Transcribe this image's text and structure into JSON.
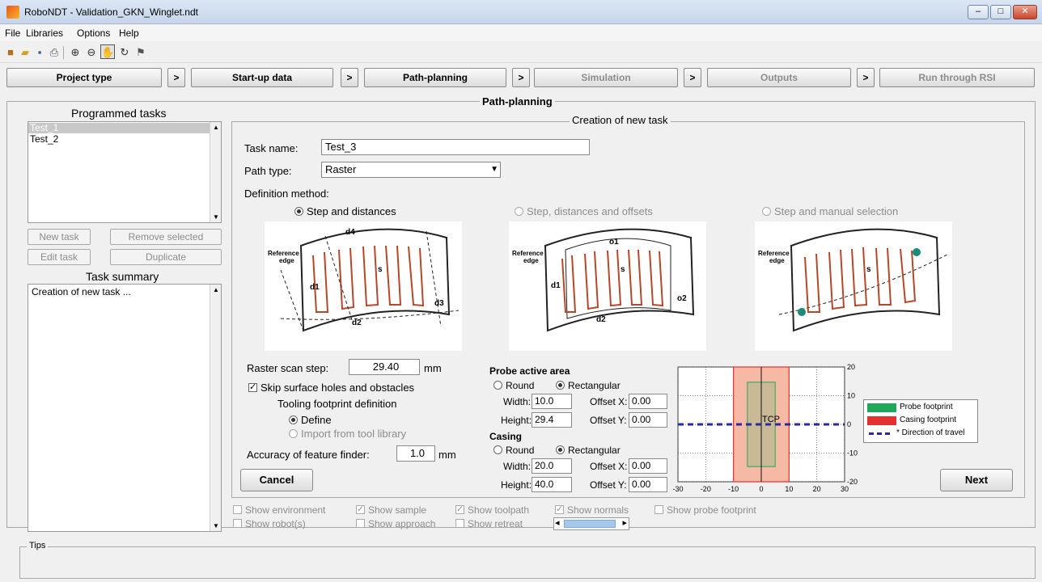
{
  "window": {
    "title": "RoboNDT - Validation_GKN_Winglet.ndt",
    "controls": {
      "minimize": "–",
      "maximize": "□",
      "close": "✕"
    }
  },
  "menu": [
    "File",
    "Libraries",
    "Options",
    "Help"
  ],
  "toolbar_icons": [
    "new-project-icon",
    "open-folder-icon",
    "save-icon",
    "print-icon",
    "zoom-in-icon",
    "zoom-out-icon",
    "pan-hand-icon",
    "rotate-3d-icon",
    "data-cursor-icon"
  ],
  "steps": [
    {
      "label": "Project type",
      "enabled": true
    },
    {
      "label": "Start-up data",
      "enabled": true
    },
    {
      "label": "Path-planning",
      "enabled": true
    },
    {
      "label": "Simulation",
      "enabled": false
    },
    {
      "label": "Outputs",
      "enabled": false
    },
    {
      "label": "Run through RSI",
      "enabled": false
    }
  ],
  "step_arrow": ">",
  "main_panel_title": "Path-planning",
  "left": {
    "programmed_title": "Programmed tasks",
    "tasks": [
      "Test_1",
      "Test_2"
    ],
    "buttons": {
      "new_task": "New task",
      "remove_selected": "Remove selected",
      "edit_task": "Edit task",
      "duplicate": "Duplicate"
    },
    "summary_title": "Task summary",
    "summary_text": "Creation of new task ..."
  },
  "creation": {
    "title": "Creation of new task",
    "task_name_label": "Task name:",
    "task_name_value": "Test_3",
    "path_type_label": "Path type:",
    "path_type_value": "Raster",
    "definition_label": "Definition method:",
    "methods": [
      {
        "label": "Step and distances",
        "selected": true,
        "enabled": true
      },
      {
        "label": "Step, distances and offsets",
        "selected": false,
        "enabled": false
      },
      {
        "label": "Step and manual selection",
        "selected": false,
        "enabled": false
      }
    ],
    "diagram_labels": {
      "reference_edge": "Reference edge",
      "reference": "Reference",
      "edge": "edge",
      "d1": "d1",
      "d2": "d2",
      "d3": "d3",
      "d4": "d4",
      "s": "s",
      "o1": "o1",
      "o2": "o2"
    },
    "raster_step_label": "Raster scan step:",
    "raster_step_value": "29.40",
    "raster_step_unit": "mm",
    "skip_holes_label": "Skip surface holes and obstacles",
    "skip_holes_checked": true,
    "tooling_label": "Tooling footprint definition",
    "define_label": "Define",
    "import_label": "Import from tool library",
    "accuracy_label": "Accuracy of feature finder:",
    "accuracy_value": "1.0",
    "accuracy_unit": "mm",
    "cancel_label": "Cancel",
    "next_label": "Next",
    "probe": {
      "title": "Probe active area",
      "round": "Round",
      "rectangular": "Rectangular",
      "width_label": "Width:",
      "width_value": "10.0",
      "height_label": "Height:",
      "height_value": "29.4",
      "offx_label": "Offset X:",
      "offx_value": "0.00",
      "offy_label": "Offset Y:",
      "offy_value": "0.00"
    },
    "casing": {
      "title": "Casing",
      "round": "Round",
      "rectangular": "Rectangular",
      "width_label": "Width:",
      "width_value": "20.0",
      "height_label": "Height:",
      "height_value": "40.0",
      "offx_label": "Offset X:",
      "offx_value": "0.00",
      "offy_label": "Offset Y:",
      "offy_value": "0.00"
    }
  },
  "chart_data": {
    "type": "area",
    "x_ticks": [
      "-30",
      "-20",
      "-10",
      "0",
      "10",
      "20",
      "30"
    ],
    "y_ticks": [
      "20",
      "10",
      "0",
      "-10",
      "-20"
    ],
    "xlim": [
      -30,
      30
    ],
    "ylim": [
      -20,
      20
    ],
    "probe_rect": {
      "x": [
        -5,
        5
      ],
      "y": [
        -14.7,
        14.7
      ]
    },
    "casing_rect": {
      "x": [
        -10,
        10
      ],
      "y": [
        -20,
        20
      ]
    },
    "tcp_label": "TCP",
    "legend": [
      {
        "label": "Probe footprint",
        "color": "#1fa85a"
      },
      {
        "label": "Casing footprint",
        "color": "#e53030"
      },
      {
        "label": "Direction of travel",
        "color": "#2a2aa0"
      }
    ],
    "grid": true
  },
  "display_options": [
    {
      "label": "Show environment",
      "checked": false
    },
    {
      "label": "Show sample",
      "checked": true
    },
    {
      "label": "Show toolpath",
      "checked": true
    },
    {
      "label": "Show normals",
      "checked": true
    },
    {
      "label": "Show probe footprint",
      "checked": false
    },
    {
      "label": "Show robot(s)",
      "checked": false
    },
    {
      "label": "Show approach",
      "checked": false
    },
    {
      "label": "Show retreat",
      "checked": false
    }
  ],
  "slider": {
    "left": "◂",
    "right": "▸"
  },
  "tips_title": "Tips"
}
